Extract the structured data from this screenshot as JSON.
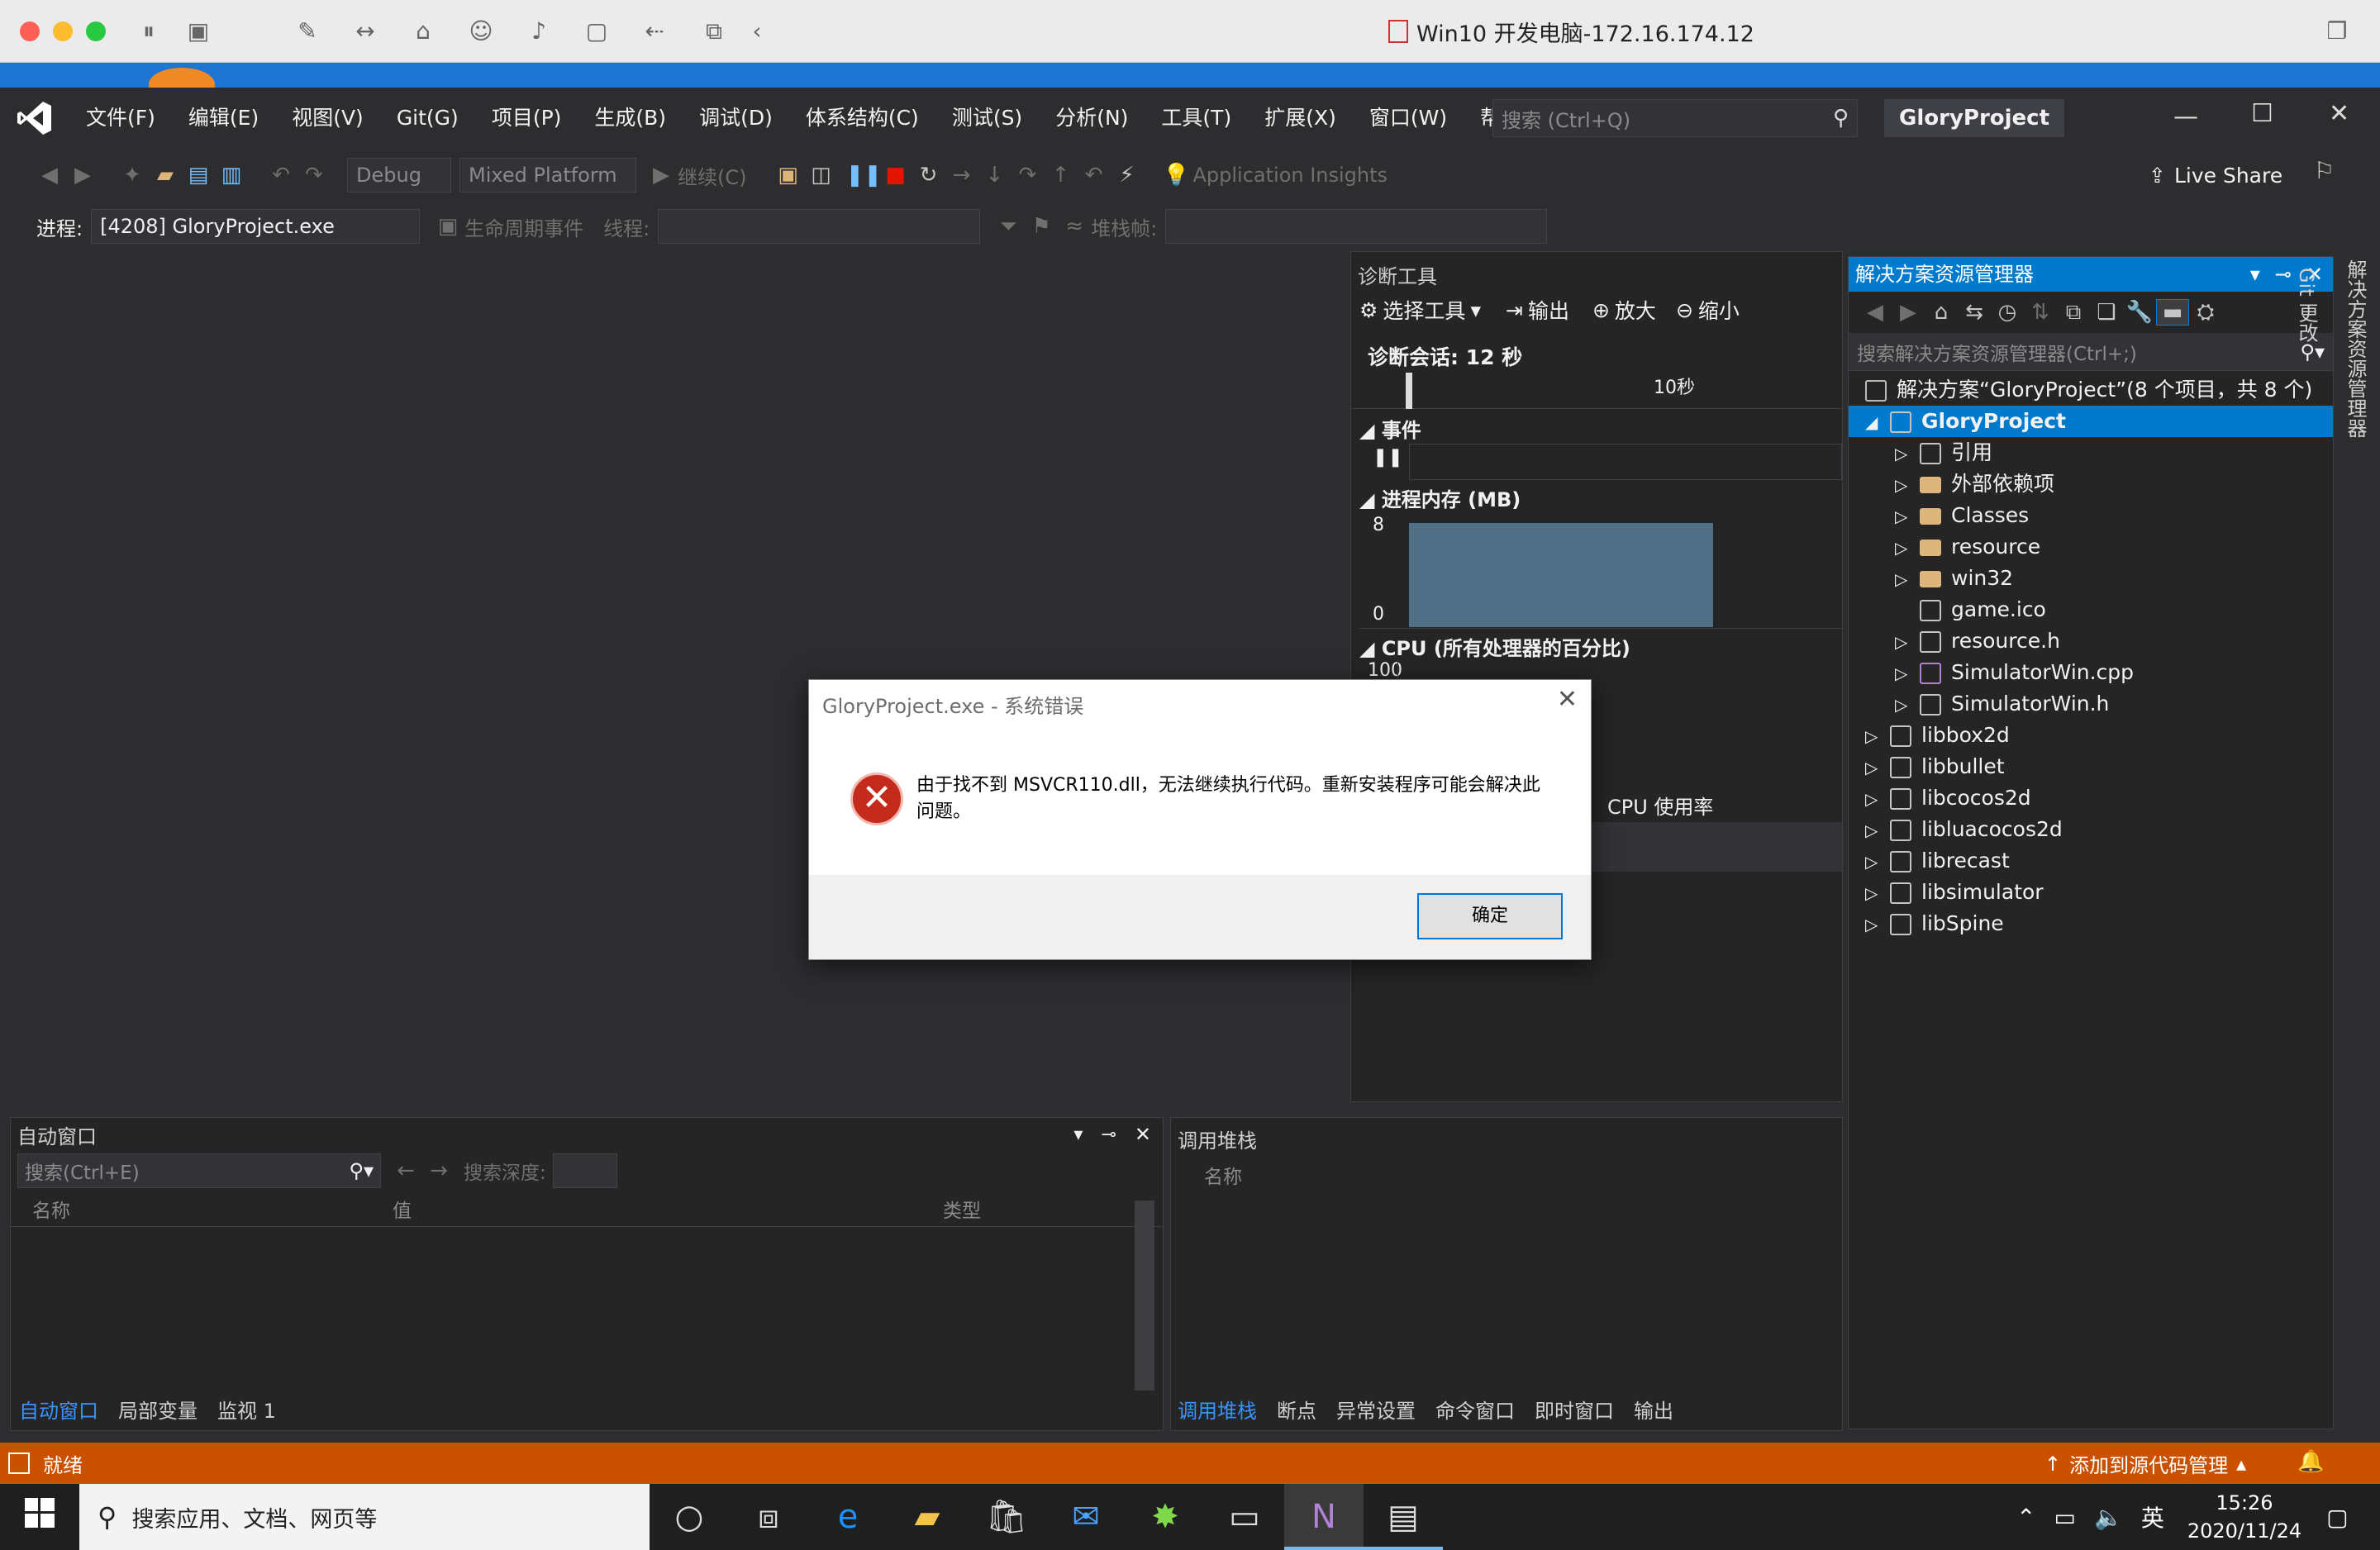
{
  "mac": {
    "window_title": "Win10 开发电脑-172.16.174.12"
  },
  "menu": [
    "文件(F)",
    "编辑(E)",
    "视图(V)",
    "Git(G)",
    "项目(P)",
    "生成(B)",
    "调试(D)",
    "体系结构(C)",
    "测试(S)",
    "分析(N)",
    "工具(T)",
    "扩展(X)",
    "窗口(W)",
    "帮助(H)"
  ],
  "search": {
    "placeholder": "搜索 (Ctrl+Q)"
  },
  "project_name": "GloryProject",
  "toolbar": {
    "config": "Debug",
    "platform": "Mixed Platform",
    "continue": "继续(C)",
    "app_insights": "Application Insights",
    "live_share": "Live Share"
  },
  "toolbar2": {
    "process_label": "进程:",
    "process_value": "[4208] GloryProject.exe",
    "lifecycle": "生命周期事件",
    "thread_label": "线程:",
    "stack_label": "堆栈帧:"
  },
  "diag": {
    "title": "诊断工具",
    "select_tool": "选择工具",
    "output": "输出",
    "zoom_in": "放大",
    "zoom_out": "缩小",
    "session": "诊断会话: 12 秒",
    "time_tick": "10秒",
    "events": "事件",
    "memory": "进程内存 (MB)",
    "mem_max": "8",
    "mem_min": "0",
    "cpu": "CPU (所有处理器的百分比)",
    "cpu_max": "100",
    "cpu_usage": "CPU 使用率"
  },
  "solution": {
    "title": "解决方案资源管理器",
    "search_placeholder": "搜索解决方案资源管理器(Ctrl+;)",
    "root": "解决方案“GloryProject”(8 个项目，共 8 个)",
    "items": [
      {
        "label": "GloryProject",
        "level": 1,
        "selected": true,
        "icon": "project-icon"
      },
      {
        "label": "引用",
        "level": 2,
        "icon": "references-icon"
      },
      {
        "label": "外部依赖项",
        "level": 2,
        "icon": "folder-icon"
      },
      {
        "label": "Classes",
        "level": 2,
        "icon": "folder-icon"
      },
      {
        "label": "resource",
        "level": 2,
        "icon": "folder-icon"
      },
      {
        "label": "win32",
        "level": 2,
        "icon": "folder-icon"
      },
      {
        "label": "game.ico",
        "level": 2,
        "icon": "image-file-icon"
      },
      {
        "label": "resource.h",
        "level": 2,
        "icon": "header-file-icon"
      },
      {
        "label": "SimulatorWin.cpp",
        "level": 2,
        "icon": "cpp-file-icon"
      },
      {
        "label": "SimulatorWin.h",
        "level": 2,
        "icon": "header-file-icon"
      },
      {
        "label": "libbox2d",
        "level": 1,
        "icon": "project-icon"
      },
      {
        "label": "libbullet",
        "level": 1,
        "icon": "project-icon"
      },
      {
        "label": "libcocos2d",
        "level": 1,
        "icon": "project-icon"
      },
      {
        "label": "libluacocos2d",
        "level": 1,
        "icon": "project-icon"
      },
      {
        "label": "librecast",
        "level": 1,
        "icon": "project-icon"
      },
      {
        "label": "libsimulator",
        "level": 1,
        "icon": "project-icon"
      },
      {
        "label": "libSpine",
        "level": 1,
        "icon": "project-icon"
      }
    ]
  },
  "side_tabs": [
    "解决方案资源管理器",
    "Git 更改"
  ],
  "autos": {
    "title": "自动窗口",
    "search_placeholder": "搜索(Ctrl+E)",
    "depth_label": "搜索深度:",
    "col_name": "名称",
    "col_value": "值",
    "col_type": "类型",
    "tabs": [
      "自动窗口",
      "局部变量",
      "监视 1"
    ]
  },
  "callstack": {
    "title": "调用堆栈",
    "col_name": "名称",
    "tabs": [
      "调用堆栈",
      "断点",
      "异常设置",
      "命令窗口",
      "即时窗口",
      "输出"
    ]
  },
  "status": {
    "ready": "就绪",
    "source_control": "添加到源代码管理"
  },
  "taskbar": {
    "search_placeholder": "搜索应用、文档、网页等",
    "ime": "英",
    "time": "15:26",
    "date": "2020/11/24"
  },
  "dialog": {
    "title": "GloryProject.exe - 系统错误",
    "message_line1": "由于找不到 MSVCR110.dll，无法继续执行代码。重新安装程序可能会解决此",
    "message_line2": "问题。",
    "ok": "确定"
  },
  "colors": {
    "accent": "#007acc",
    "status_bar": "#ca5100",
    "error_red": "#c42b1c"
  }
}
